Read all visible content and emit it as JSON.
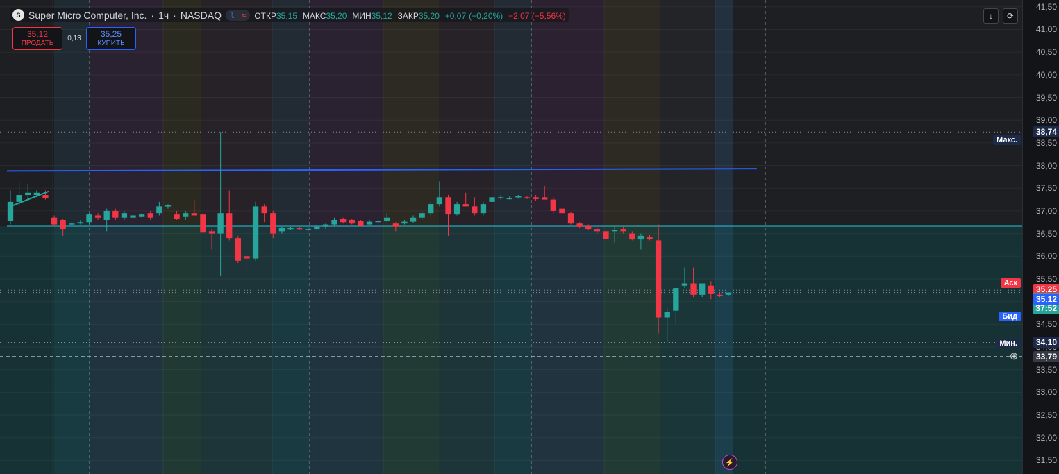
{
  "legend": {
    "logo_text": "S",
    "symbol": "Super Micro Computer, Inc.",
    "interval": "1ч",
    "exchange": "NASDAQ",
    "open_label": "ОТКР",
    "open_value": "35,15",
    "high_label": "МАКС",
    "high_value": "35,20",
    "low_label": "МИН",
    "low_value": "35,12",
    "close_label": "ЗАКР",
    "close_value": "35,20",
    "change_abs": "+0,07",
    "change_pct": "(+0,20%)",
    "day_change": "−2,07 (−5,56%)",
    "separator": "·",
    "moon_icon": "☾",
    "wave_icon": "≈"
  },
  "trade": {
    "sell_price": "35,12",
    "sell_label": "ПРОДАТЬ",
    "spread": "0,13",
    "buy_price": "35,25",
    "buy_label": "КУПИТЬ"
  },
  "top_buttons": {
    "download_icon": "↓",
    "refresh_icon": "⟳"
  },
  "alert_icon": "⚡",
  "colors": {
    "up": "#26a69a",
    "down": "#f23645",
    "blue_line": "#2962ff",
    "cyan_line": "#26c6da",
    "ask": "#f23645",
    "bid": "#2962ff"
  },
  "price_axis": {
    "ticks": [
      "41,50",
      "41,00",
      "40,50",
      "40,00",
      "39,50",
      "39,00",
      "38,50",
      "38,00",
      "37,50",
      "37,00",
      "36,50",
      "36,00",
      "35,50",
      "35,00",
      "34,50",
      "34,00",
      "33,50",
      "33,00",
      "32,50",
      "32,00",
      "31,50"
    ],
    "max_label": "Макс.",
    "max_value": "38,74",
    "ask_label": "Аск",
    "ask_value": "35,25",
    "last_price": "35,20",
    "countdown": "37:52",
    "bid_label": "Бид",
    "bid_value": "35,12",
    "min_label": "Мин.",
    "min_value": "34,10",
    "crosshair_value": "33,79"
  },
  "chart_data": {
    "type": "candlestick",
    "ylim": [
      31.2,
      41.65
    ],
    "candles": [
      {
        "o": 36.78,
        "h": 37.45,
        "l": 36.7,
        "c": 37.2
      },
      {
        "o": 37.2,
        "h": 37.65,
        "l": 37.1,
        "c": 37.35
      },
      {
        "o": 37.35,
        "h": 37.6,
        "l": 37.25,
        "c": 37.4
      },
      {
        "o": 37.35,
        "h": 37.45,
        "l": 37.3,
        "c": 37.4
      },
      {
        "o": 37.35,
        "h": 37.45,
        "l": 37.25,
        "c": 37.28
      },
      {
        "o": 36.85,
        "h": 36.9,
        "l": 36.65,
        "c": 36.7
      },
      {
        "o": 36.8,
        "h": 36.82,
        "l": 36.45,
        "c": 36.6
      },
      {
        "o": 36.7,
        "h": 36.75,
        "l": 36.68,
        "c": 36.72
      },
      {
        "o": 36.72,
        "h": 36.8,
        "l": 36.7,
        "c": 36.75
      },
      {
        "o": 36.75,
        "h": 36.95,
        "l": 36.7,
        "c": 36.92
      },
      {
        "o": 36.9,
        "h": 36.95,
        "l": 36.8,
        "c": 36.85
      },
      {
        "o": 36.8,
        "h": 37.05,
        "l": 36.55,
        "c": 37.0
      },
      {
        "o": 37.0,
        "h": 37.05,
        "l": 36.8,
        "c": 36.85
      },
      {
        "o": 36.85,
        "h": 37.0,
        "l": 36.8,
        "c": 36.95
      },
      {
        "o": 36.85,
        "h": 36.95,
        "l": 36.8,
        "c": 36.9
      },
      {
        "o": 36.88,
        "h": 36.95,
        "l": 36.85,
        "c": 36.92
      },
      {
        "o": 36.95,
        "h": 37.0,
        "l": 36.8,
        "c": 36.85
      },
      {
        "o": 36.95,
        "h": 37.2,
        "l": 36.9,
        "c": 37.1
      },
      {
        "o": 37.1,
        "h": 37.15,
        "l": 37.05,
        "c": 37.12
      },
      {
        "o": 36.92,
        "h": 37.0,
        "l": 36.8,
        "c": 36.82
      },
      {
        "o": 36.88,
        "h": 37.0,
        "l": 36.8,
        "c": 36.95
      },
      {
        "o": 36.95,
        "h": 37.25,
        "l": 36.9,
        "c": 36.9
      },
      {
        "o": 36.92,
        "h": 36.95,
        "l": 36.5,
        "c": 36.52
      },
      {
        "o": 36.55,
        "h": 36.6,
        "l": 36.15,
        "c": 36.5
      },
      {
        "o": 36.5,
        "h": 38.74,
        "l": 35.57,
        "c": 36.95
      },
      {
        "o": 36.95,
        "h": 37.45,
        "l": 36.35,
        "c": 36.4
      },
      {
        "o": 36.4,
        "h": 36.45,
        "l": 35.85,
        "c": 35.9
      },
      {
        "o": 36.0,
        "h": 36.05,
        "l": 35.65,
        "c": 35.95
      },
      {
        "o": 35.95,
        "h": 37.2,
        "l": 35.9,
        "c": 37.1
      },
      {
        "o": 37.1,
        "h": 37.15,
        "l": 36.75,
        "c": 36.95
      },
      {
        "o": 36.95,
        "h": 37.0,
        "l": 36.4,
        "c": 36.5
      },
      {
        "o": 36.55,
        "h": 36.65,
        "l": 36.5,
        "c": 36.62
      },
      {
        "o": 36.6,
        "h": 36.65,
        "l": 36.58,
        "c": 36.62
      },
      {
        "o": 36.62,
        "h": 36.65,
        "l": 36.58,
        "c": 36.6
      },
      {
        "o": 36.58,
        "h": 36.65,
        "l": 36.55,
        "c": 36.6
      },
      {
        "o": 36.6,
        "h": 36.7,
        "l": 36.57,
        "c": 36.65
      },
      {
        "o": 36.65,
        "h": 36.72,
        "l": 36.6,
        "c": 36.7
      },
      {
        "o": 36.7,
        "h": 36.85,
        "l": 36.65,
        "c": 36.8
      },
      {
        "o": 36.82,
        "h": 36.85,
        "l": 36.72,
        "c": 36.75
      },
      {
        "o": 36.8,
        "h": 36.82,
        "l": 36.7,
        "c": 36.72
      },
      {
        "o": 36.78,
        "h": 36.8,
        "l": 36.65,
        "c": 36.68
      },
      {
        "o": 36.7,
        "h": 36.8,
        "l": 36.68,
        "c": 36.76
      },
      {
        "o": 36.75,
        "h": 36.8,
        "l": 36.7,
        "c": 36.78
      },
      {
        "o": 36.78,
        "h": 36.95,
        "l": 36.75,
        "c": 36.85
      },
      {
        "o": 36.72,
        "h": 36.75,
        "l": 36.55,
        "c": 36.65
      },
      {
        "o": 36.72,
        "h": 36.8,
        "l": 36.7,
        "c": 36.76
      },
      {
        "o": 36.76,
        "h": 36.9,
        "l": 36.74,
        "c": 36.85
      },
      {
        "o": 36.85,
        "h": 37.0,
        "l": 36.8,
        "c": 36.95
      },
      {
        "o": 36.95,
        "h": 37.2,
        "l": 36.9,
        "c": 37.15
      },
      {
        "o": 37.15,
        "h": 37.65,
        "l": 37.1,
        "c": 37.3
      },
      {
        "o": 37.3,
        "h": 37.35,
        "l": 36.45,
        "c": 36.92
      },
      {
        "o": 36.92,
        "h": 37.2,
        "l": 36.9,
        "c": 37.15
      },
      {
        "o": 37.15,
        "h": 37.4,
        "l": 37.1,
        "c": 37.1
      },
      {
        "o": 37.1,
        "h": 37.3,
        "l": 36.9,
        "c": 36.95
      },
      {
        "o": 36.95,
        "h": 37.2,
        "l": 36.9,
        "c": 37.15
      },
      {
        "o": 37.2,
        "h": 37.5,
        "l": 37.15,
        "c": 37.3
      },
      {
        "o": 37.28,
        "h": 37.35,
        "l": 37.25,
        "c": 37.3
      },
      {
        "o": 37.28,
        "h": 37.32,
        "l": 37.25,
        "c": 37.28
      },
      {
        "o": 37.3,
        "h": 37.35,
        "l": 37.27,
        "c": 37.32
      },
      {
        "o": 37.3,
        "h": 37.32,
        "l": 37.26,
        "c": 37.28
      },
      {
        "o": 37.3,
        "h": 37.35,
        "l": 37.22,
        "c": 37.26
      },
      {
        "o": 37.3,
        "h": 37.55,
        "l": 37.25,
        "c": 37.25
      },
      {
        "o": 37.25,
        "h": 37.3,
        "l": 36.95,
        "c": 37.0
      },
      {
        "o": 37.05,
        "h": 37.1,
        "l": 36.9,
        "c": 36.95
      },
      {
        "o": 36.95,
        "h": 36.98,
        "l": 36.7,
        "c": 36.72
      },
      {
        "o": 36.72,
        "h": 36.75,
        "l": 36.62,
        "c": 36.65
      },
      {
        "o": 36.68,
        "h": 36.7,
        "l": 36.58,
        "c": 36.6
      },
      {
        "o": 36.6,
        "h": 36.62,
        "l": 36.5,
        "c": 36.55
      },
      {
        "o": 36.55,
        "h": 36.58,
        "l": 36.35,
        "c": 36.38
      },
      {
        "o": 36.55,
        "h": 36.65,
        "l": 36.3,
        "c": 36.58
      },
      {
        "o": 36.6,
        "h": 36.65,
        "l": 36.5,
        "c": 36.55
      },
      {
        "o": 36.5,
        "h": 36.55,
        "l": 36.35,
        "c": 36.37
      },
      {
        "o": 36.37,
        "h": 36.5,
        "l": 36.15,
        "c": 36.45
      },
      {
        "o": 36.42,
        "h": 36.48,
        "l": 36.35,
        "c": 36.38
      },
      {
        "o": 36.35,
        "h": 36.7,
        "l": 34.3,
        "c": 34.65
      },
      {
        "o": 34.65,
        "h": 34.85,
        "l": 34.1,
        "c": 34.78
      },
      {
        "o": 34.8,
        "h": 35.3,
        "l": 34.5,
        "c": 35.3
      },
      {
        "o": 35.35,
        "h": 35.75,
        "l": 35.3,
        "c": 35.4
      },
      {
        "o": 35.4,
        "h": 35.75,
        "l": 35.1,
        "c": 35.15
      },
      {
        "o": 35.15,
        "h": 35.4,
        "l": 35.1,
        "c": 35.4
      },
      {
        "o": 35.35,
        "h": 35.45,
        "l": 35.05,
        "c": 35.18
      },
      {
        "o": 35.15,
        "h": 35.2,
        "l": 35.1,
        "c": 35.13
      },
      {
        "o": 35.15,
        "h": 35.2,
        "l": 35.12,
        "c": 35.2
      }
    ],
    "trend_line_blue": {
      "from": 37.88,
      "to": 37.93
    },
    "trend_line_green": {
      "from": 37.08,
      "to": 37.43
    },
    "cyan_level": 36.67,
    "max_level": 38.74,
    "min_level": 34.1,
    "ask_level": 35.25,
    "last_level": 35.2,
    "bid_level": 35.12,
    "crosshair_level": 33.79,
    "tick_min": 31.5,
    "tick_max": 41.5,
    "tick_step": 0.5
  }
}
